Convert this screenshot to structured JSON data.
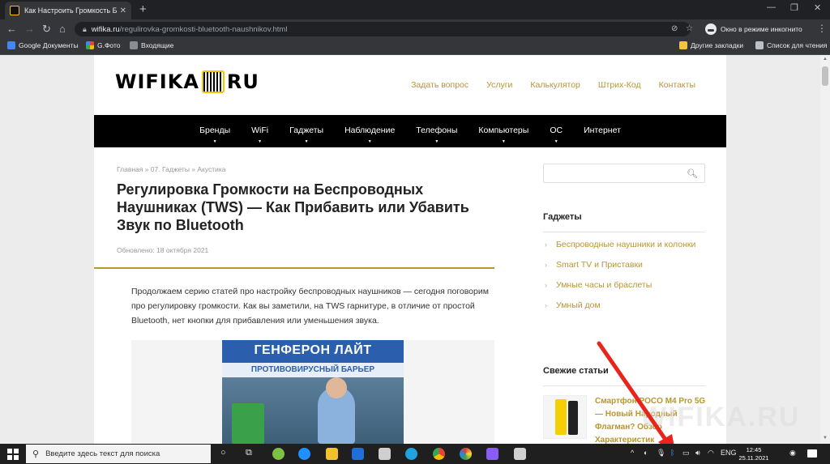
{
  "browser": {
    "tab_title": "Как Настроить Громкость Беспро",
    "tab_close": "✕",
    "new_tab": "+",
    "url_host": "wifika.ru",
    "url_path": "/regulirovka-gromkosti-bluetooth-naushnikov.html",
    "incognito_label": "Окно в режиме инкогнито",
    "bookmarks": [
      "Google Документы",
      "G.Фото",
      "Входящие"
    ],
    "other_bookmarks": "Другие закладки",
    "reading_list": "Список для чтения",
    "colors": {
      "chrome_dark": "#202124",
      "chrome_bar": "#35363a"
    }
  },
  "site": {
    "logo_left": "WIFIKA",
    "logo_right": "RU",
    "top_nav": [
      "Задать вопрос",
      "Услуги",
      "Калькулятор",
      "Штрих-Код",
      "Контакты"
    ],
    "main_nav": [
      "Бренды",
      "WiFi",
      "Гаджеты",
      "Наблюдение",
      "Телефоны",
      "Компьютеры",
      "ОС",
      "Интернет"
    ],
    "breadcrumbs": "Главная » 07. Гаджеты » Акустика",
    "title": "Регулировка Громкости на Беспроводных Наушниках (TWS) — Как Прибавить или Убавить Звук по Bluetooth",
    "updated": "Обновлено: 18 октября 2021",
    "lead": "Продолжаем серию статей про настройку беспроводных наушников — сегодня поговорим про регулировку громкости. Как вы заметили, на TWS гарнитуре, в отличие от простой Bluetooth, нет кнопки для прибавления или уменьшения звука.",
    "ad": {
      "brand": "ГЕНФЕРОН ЛАЙТ",
      "strip": "ПРОТИВОВИРУСНЫЙ БАРЬЕР"
    },
    "accent_color": "#b8962e",
    "sidebar": {
      "search_placeholder": "",
      "gadgets_heading": "Гаджеты",
      "gadgets_items": [
        "Беспроводные наушники и колонки",
        "Smart TV и Приставки",
        "Умные часы и браслеты",
        "Умный дом"
      ],
      "fresh_heading": "Свежие статьи",
      "fresh_post": "Смартфон POCO M4 Pro 5G — Новый Народный Флагман? Обзор Характеристик"
    },
    "watermark": "WIFIKA.RU"
  },
  "taskbar": {
    "search_placeholder": "Введите здесь текст для поиска",
    "lang": "ENG",
    "time": "12:45",
    "date": "25.11.2021"
  }
}
